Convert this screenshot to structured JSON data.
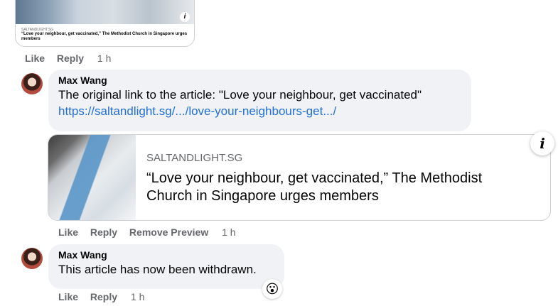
{
  "top_preview": {
    "domain": "SALTANDLIGHT.SG",
    "title": "“Love your neighbour, get vaccinated,” The Methodist Church in Singapore urges members",
    "info_glyph": "i"
  },
  "actions_1": {
    "like": "Like",
    "reply": "Reply",
    "time": "1 h"
  },
  "comment_1": {
    "author": "Max Wang",
    "text": "The original link to the article: \"Love your neighbour, get vaccinated\"",
    "link": "https://saltandlight.sg/.../love-your-neighbours-get.../"
  },
  "link_preview": {
    "domain": "SALTANDLIGHT.SG",
    "title": "“Love your neighbour, get vaccinated,” The Methodist Church in Singapore urges members",
    "info_glyph": "i"
  },
  "actions_2": {
    "like": "Like",
    "reply": "Reply",
    "remove_preview": "Remove Preview",
    "time": "1 h"
  },
  "comment_2": {
    "author": "Max Wang",
    "text": "This article has now been withdrawn.",
    "reaction": "😮"
  },
  "actions_3": {
    "like": "Like",
    "reply": "Reply",
    "time": "1 h"
  },
  "icons": {
    "info": "info-icon",
    "reaction": "wow-reaction-icon"
  },
  "colors": {
    "link": "#216fdb",
    "bubble": "#f0f2f5",
    "muted": "#65676b"
  }
}
